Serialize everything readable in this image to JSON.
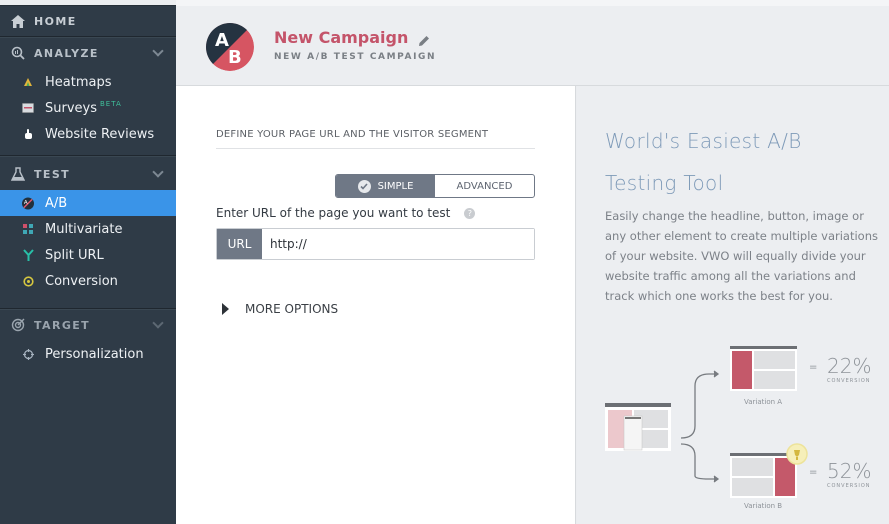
{
  "sidebar": {
    "home": {
      "label": "HOME",
      "icon": "home-icon"
    },
    "sections": [
      {
        "label": "ANALYZE",
        "icon": "analyze-icon",
        "items": [
          {
            "label": "Heatmaps",
            "icon": "heatmap-icon"
          },
          {
            "label": "Surveys",
            "icon": "survey-icon",
            "badge": "BETA"
          },
          {
            "label": "Website Reviews",
            "icon": "hand-pointer-icon"
          }
        ]
      },
      {
        "label": "TEST",
        "icon": "flask-icon",
        "items": [
          {
            "label": "A/B",
            "icon": "ab-icon",
            "active": true
          },
          {
            "label": "Multivariate",
            "icon": "grid-icon"
          },
          {
            "label": "Split URL",
            "icon": "split-icon"
          },
          {
            "label": "Conversion",
            "icon": "conversion-icon"
          }
        ]
      },
      {
        "label": "TARGET",
        "icon": "target-icon",
        "items": [
          {
            "label": "Personalization",
            "icon": "crosshair-icon"
          }
        ]
      }
    ]
  },
  "header": {
    "logo_letters": [
      "A",
      "B"
    ],
    "title": "New Campaign",
    "subtitle": "NEW A/B TEST CAMPAIGN"
  },
  "form": {
    "section_title": "DEFINE YOUR PAGE URL AND THE VISITOR SEGMENT",
    "toggle": {
      "options": [
        "SIMPLE",
        "ADVANCED"
      ],
      "selected": "SIMPLE"
    },
    "url_label": "Enter URL of the page you want to test",
    "help_glyph": "?",
    "url_prefix": "URL",
    "url_value": "http://",
    "more_options": "MORE OPTIONS"
  },
  "promo": {
    "title": "World's Easiest A/B Testing Tool",
    "body": "Easily change the headline, button, image or any other element to create multiple variations of your website. VWO will equally divide your website traffic among all the variations and track which one works the best for you.",
    "variations": [
      {
        "label": "Variation A",
        "percent": "22%",
        "caption": "CONVERSION"
      },
      {
        "label": "Variation B",
        "percent": "52%",
        "caption": "CONVERSION",
        "winner": true
      }
    ],
    "equals": "=",
    "colors": {
      "accent_red": "#c4596a",
      "title_blue": "#7e9ab8"
    }
  },
  "colors": {
    "sidebar_bg": "#2f3b47",
    "active_item": "#3a94e8",
    "campaign_title": "#c4546a",
    "toggle_active": "#6f7886"
  }
}
